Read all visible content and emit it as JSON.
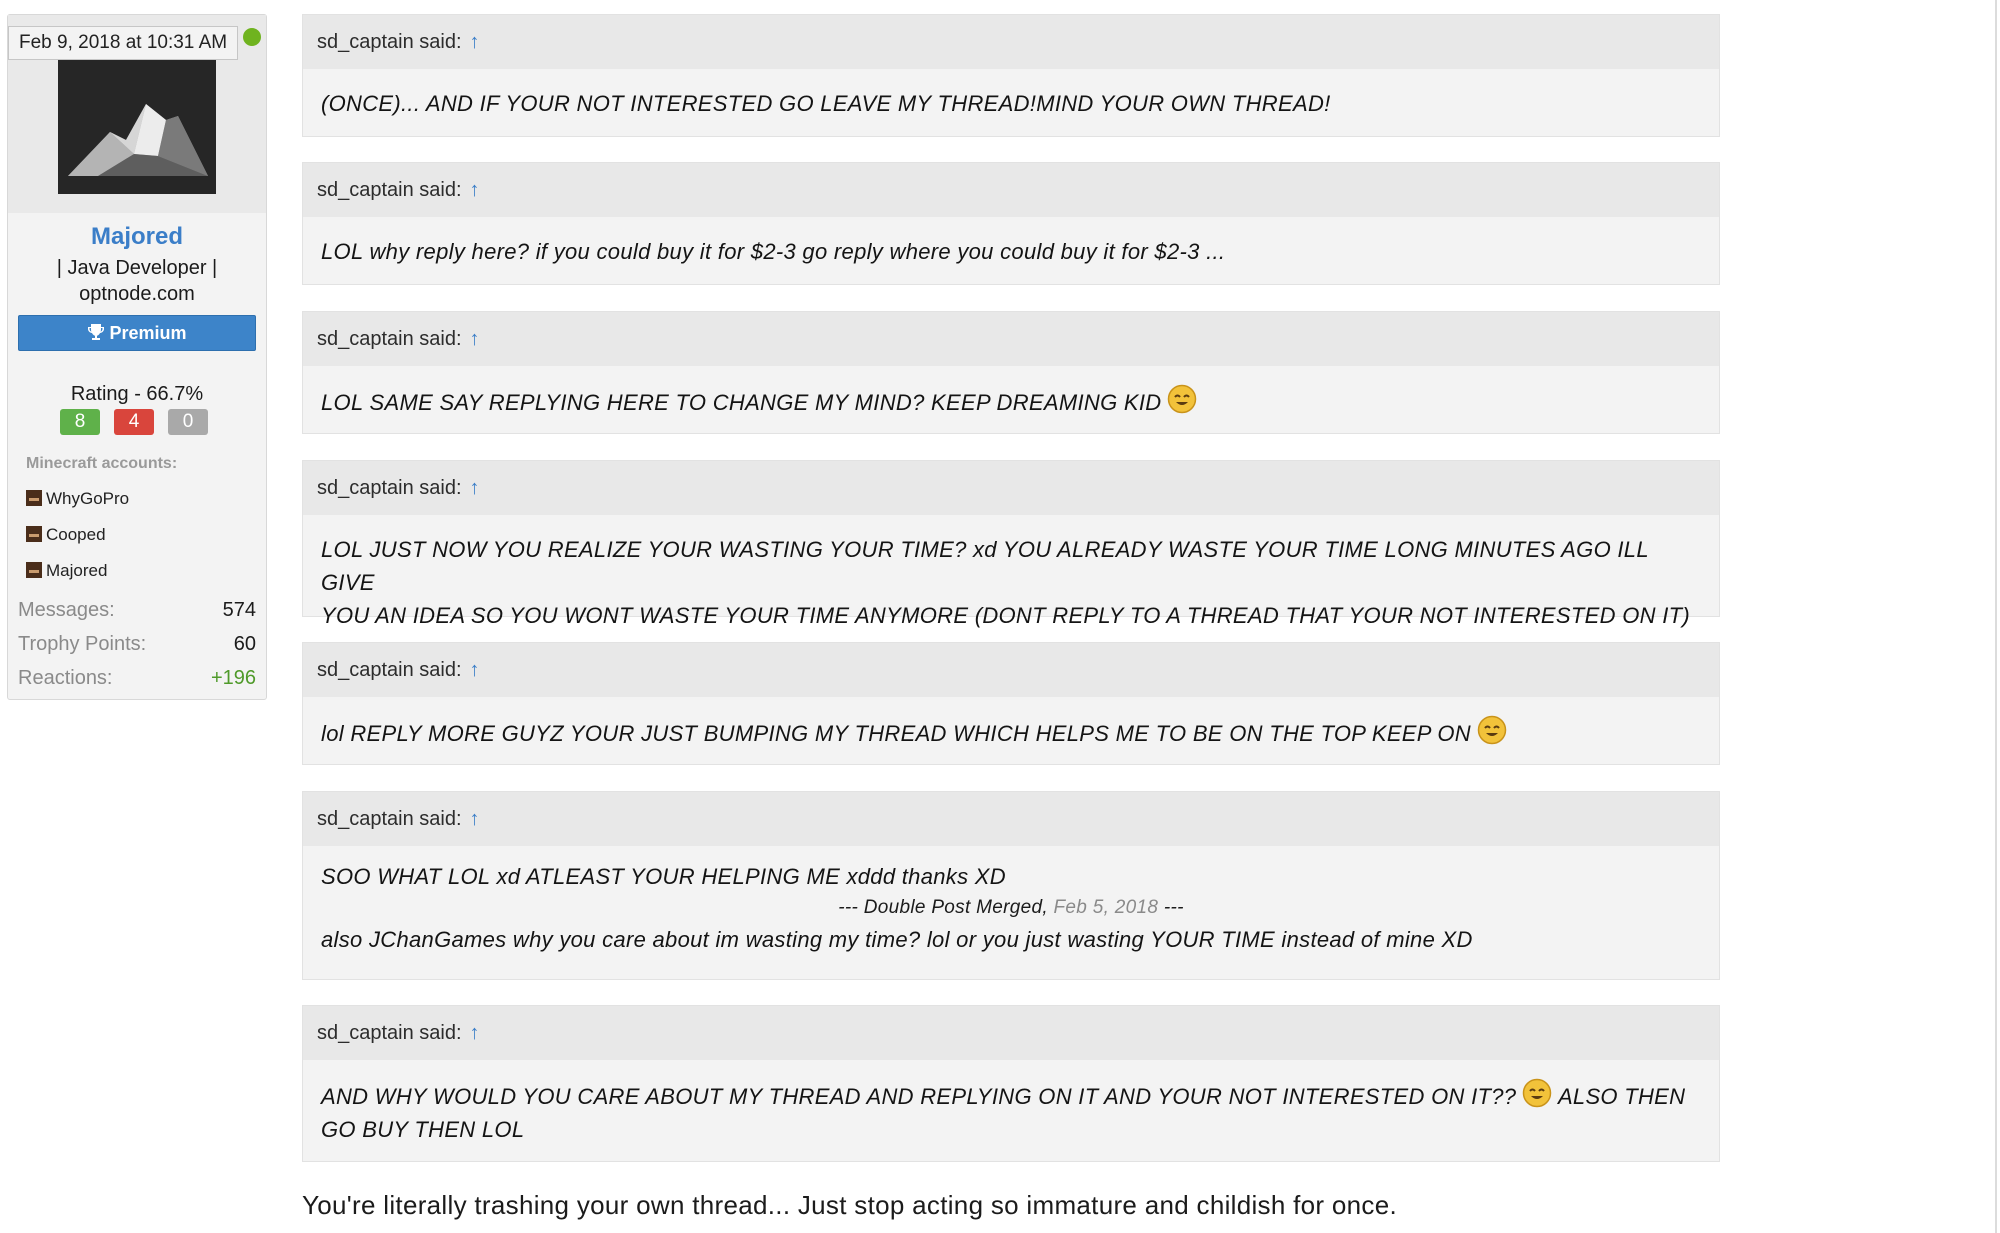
{
  "user": {
    "post_date": "Feb 9, 2018 at 10:31 AM",
    "name": "Majored",
    "title_line1": "| Java Developer |",
    "title_line2": "optnode.com",
    "premium_label": "Premium",
    "rating_label": "Rating - 66.7%",
    "rating": {
      "positive": "8",
      "negative": "4",
      "neutral": "0"
    },
    "minecraft_header": "Minecraft accounts:",
    "minecraft_accounts": [
      "WhyGoPro",
      "Cooped",
      "Majored"
    ],
    "stats": [
      {
        "label": "Messages:",
        "value": "574"
      },
      {
        "label": "Trophy Points:",
        "value": "60"
      },
      {
        "label": "Reactions:",
        "value": "+196"
      }
    ],
    "colors": {
      "online": "#6fb31f",
      "premium": "#3d84c9",
      "username": "#3b7ec8"
    }
  },
  "quotes": [
    {
      "author": "sd_captain said:",
      "text": "(ONCE)... AND IF YOUR NOT INTERESTED GO LEAVE MY THREAD!MIND YOUR OWN THREAD!"
    },
    {
      "author": "sd_captain said:",
      "text": "LOL why reply here? if you could buy it for $2-3 go reply where you could buy it for $2-3 ..."
    },
    {
      "author": "sd_captain said:",
      "text": "LOL SAME SAY REPLYING HERE TO CHANGE MY MIND? KEEP DREAMING KID",
      "icon": "smiley-icon"
    },
    {
      "author": "sd_captain said:",
      "line1": "LOL JUST NOW YOU REALIZE YOUR WASTING YOUR TIME? xd YOU ALREADY WASTE YOUR TIME LONG MINUTES AGO ILL GIVE",
      "line2": "YOU AN IDEA SO YOU WONT WASTE YOUR TIME ANYMORE (DONT REPLY TO A THREAD THAT YOUR NOT INTERESTED ON IT)"
    },
    {
      "author": "sd_captain said:",
      "text": "lol REPLY MORE GUYZ YOUR JUST BUMPING MY THREAD WHICH HELPS ME TO BE ON THE TOP KEEP ON",
      "icon": "smiley-icon"
    },
    {
      "author": "sd_captain said:",
      "line1": "SOO WHAT LOL xd ATLEAST YOUR HELPING ME xddd thanks XD",
      "merge_prefix": "--- Double Post Merged,",
      "merge_date": "Feb 5, 2018",
      "merge_suffix": "---",
      "line2": "also JChanGames why you care about im wasting my time? lol or you just wasting YOUR TIME instead of mine XD"
    },
    {
      "author": "sd_captain said:",
      "line1_a": "AND WHY WOULD YOU CARE ABOUT MY THREAD AND REPLYING ON IT AND YOUR NOT INTERESTED ON IT??",
      "line1_b": "ALSO THEN",
      "line2": "GO BUY THEN LOL",
      "icon": "smiley-icon"
    }
  ],
  "quote_arrow": "↑",
  "reply": "You're literally trashing your own thread... Just stop acting so immature and childish for once."
}
